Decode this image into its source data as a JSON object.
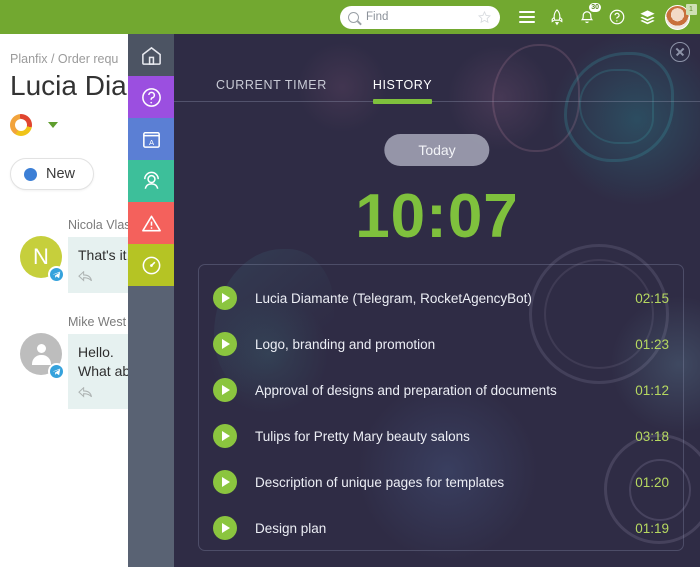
{
  "topbar": {
    "search": {
      "placeholder": "Find",
      "value": ""
    },
    "icons": [
      {
        "name": "star-icon",
        "label": "star"
      },
      {
        "name": "hamburger-menu-icon",
        "label": "menu"
      },
      {
        "name": "rocket-icon",
        "label": "rocket"
      },
      {
        "name": "notifications-bell-icon",
        "label": "notifications",
        "badge": "30"
      },
      {
        "name": "help-icon",
        "label": "?"
      },
      {
        "name": "layers-icon",
        "label": "layers"
      }
    ],
    "avatar_badge": "1",
    "accent_color": "#72a830"
  },
  "background_page": {
    "breadcrumb": "Planfix / Order requ",
    "title": "Lucia Dian",
    "status": {
      "label": "New",
      "dot_color": "#3c7fd6"
    },
    "chat": [
      {
        "author": "Nicola Vlasi",
        "message": "That's it.",
        "avatar_letter": "N",
        "avatar_kind": "letter",
        "channel": "telegram"
      },
      {
        "author": "Mike West",
        "message_line1": "Hello.",
        "message_line2": "What ab",
        "avatar_kind": "person",
        "channel": "telegram"
      }
    ]
  },
  "modal": {
    "close_label": "close",
    "rail": [
      {
        "name": "home-icon",
        "label": "Home",
        "color": "#4c5463"
      },
      {
        "name": "help-question-icon",
        "label": "Help",
        "color": "#9b4fe0"
      },
      {
        "name": "dictionary-icon",
        "label": "Glossary",
        "color": "#5b7fd4"
      },
      {
        "name": "support-agent-icon",
        "label": "Support",
        "color": "#3dbf9a"
      },
      {
        "name": "alert-triangle-icon",
        "label": "Alerts",
        "color": "#f4615c"
      },
      {
        "name": "speedometer-icon",
        "label": "Dashboard",
        "color": "#b5c424"
      }
    ],
    "tabs": [
      {
        "label": "CURRENT TIMER",
        "active": false
      },
      {
        "label": "HISTORY",
        "active": true
      }
    ],
    "day_pill": "Today",
    "total_time": "10:07",
    "accent_green": "#7fc13d",
    "tasks": [
      {
        "title": "Lucia Diamante (Telegram, RocketAgencyBot)",
        "time": "02:15"
      },
      {
        "title": "Logo, branding and promotion",
        "time": "01:23"
      },
      {
        "title": "Approval of designs and preparation of documents",
        "time": "01:12"
      },
      {
        "title": "Tulips for Pretty Mary beauty salons",
        "time": "03:18"
      },
      {
        "title": "Description of unique pages for templates",
        "time": "01:20"
      },
      {
        "title": "Design plan",
        "time": "01:19"
      }
    ]
  }
}
